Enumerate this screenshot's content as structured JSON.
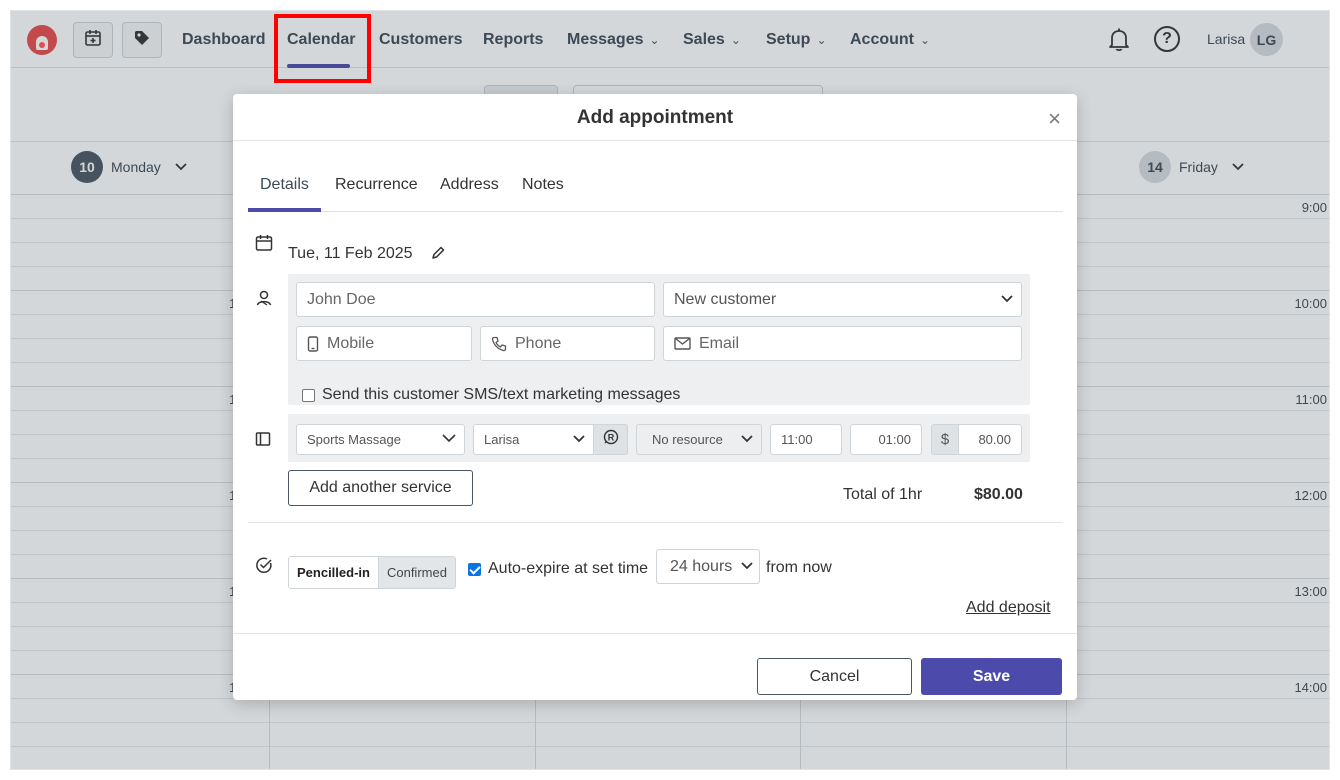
{
  "nav": {
    "items": [
      {
        "label": "Dashboard",
        "dropdown": false
      },
      {
        "label": "Calendar",
        "dropdown": false,
        "active": true
      },
      {
        "label": "Customers",
        "dropdown": false
      },
      {
        "label": "Reports",
        "dropdown": false
      },
      {
        "label": "Messages",
        "dropdown": true
      },
      {
        "label": "Sales",
        "dropdown": true
      },
      {
        "label": "Setup",
        "dropdown": true
      },
      {
        "label": "Account",
        "dropdown": true
      }
    ],
    "user_name": "Larisa",
    "user_initials": "LG",
    "help_glyph": "?"
  },
  "calendar": {
    "days": [
      {
        "num": "10",
        "name": "Monday"
      },
      {
        "num": "14",
        "name": "Friday"
      }
    ],
    "hours": [
      "9:00",
      "10:00",
      "11:00",
      "12:00",
      "13:00",
      "14:00"
    ],
    "left_hour_fragment": "1"
  },
  "modal": {
    "title": "Add appointment",
    "close_glyph": "×",
    "tabs": [
      "Details",
      "Recurrence",
      "Address",
      "Notes"
    ],
    "active_tab": "Details",
    "date": "Tue, 11 Feb 2025",
    "customer": {
      "name_placeholder": "John Doe",
      "type_selected": "New customer",
      "mobile_placeholder": "Mobile",
      "phone_placeholder": "Phone",
      "email_placeholder": "Email",
      "marketing_label": "Send this customer SMS/text marketing messages",
      "marketing_checked": false
    },
    "service": {
      "service_selected": "Sports Massage",
      "staff_selected": "Larisa",
      "resource_selected": "No resource",
      "start_time": "11:00",
      "duration": "01:00",
      "currency_symbol": "$",
      "price": "80.00"
    },
    "add_service_label": "Add another service",
    "total_label": "Total of 1hr",
    "total_value": "$80.00",
    "status": {
      "pencilled_label": "Pencilled-in",
      "confirmed_label": "Confirmed",
      "active": "Pencilled-in"
    },
    "auto_expire": {
      "label": "Auto-expire at set time",
      "checked": true,
      "hours_selected": "24 hours",
      "suffix": "from now"
    },
    "add_deposit_label": "Add deposit",
    "cancel_label": "Cancel",
    "save_label": "Save"
  },
  "colors": {
    "accent": "#4c4bab",
    "brand_logo": "#e84b4b",
    "highlight_box": "#ff0000",
    "checkbox": "#0b74de"
  },
  "icons": [
    "calendar-plus-icon",
    "tag-icon",
    "bell-icon",
    "help-icon",
    "calendar-icon",
    "pencil-icon",
    "person-icon",
    "mobile-icon",
    "phone-icon",
    "mail-icon",
    "service-icon",
    "resource-icon",
    "check-circle-icon",
    "close-icon",
    "chevron-down-icon"
  ]
}
